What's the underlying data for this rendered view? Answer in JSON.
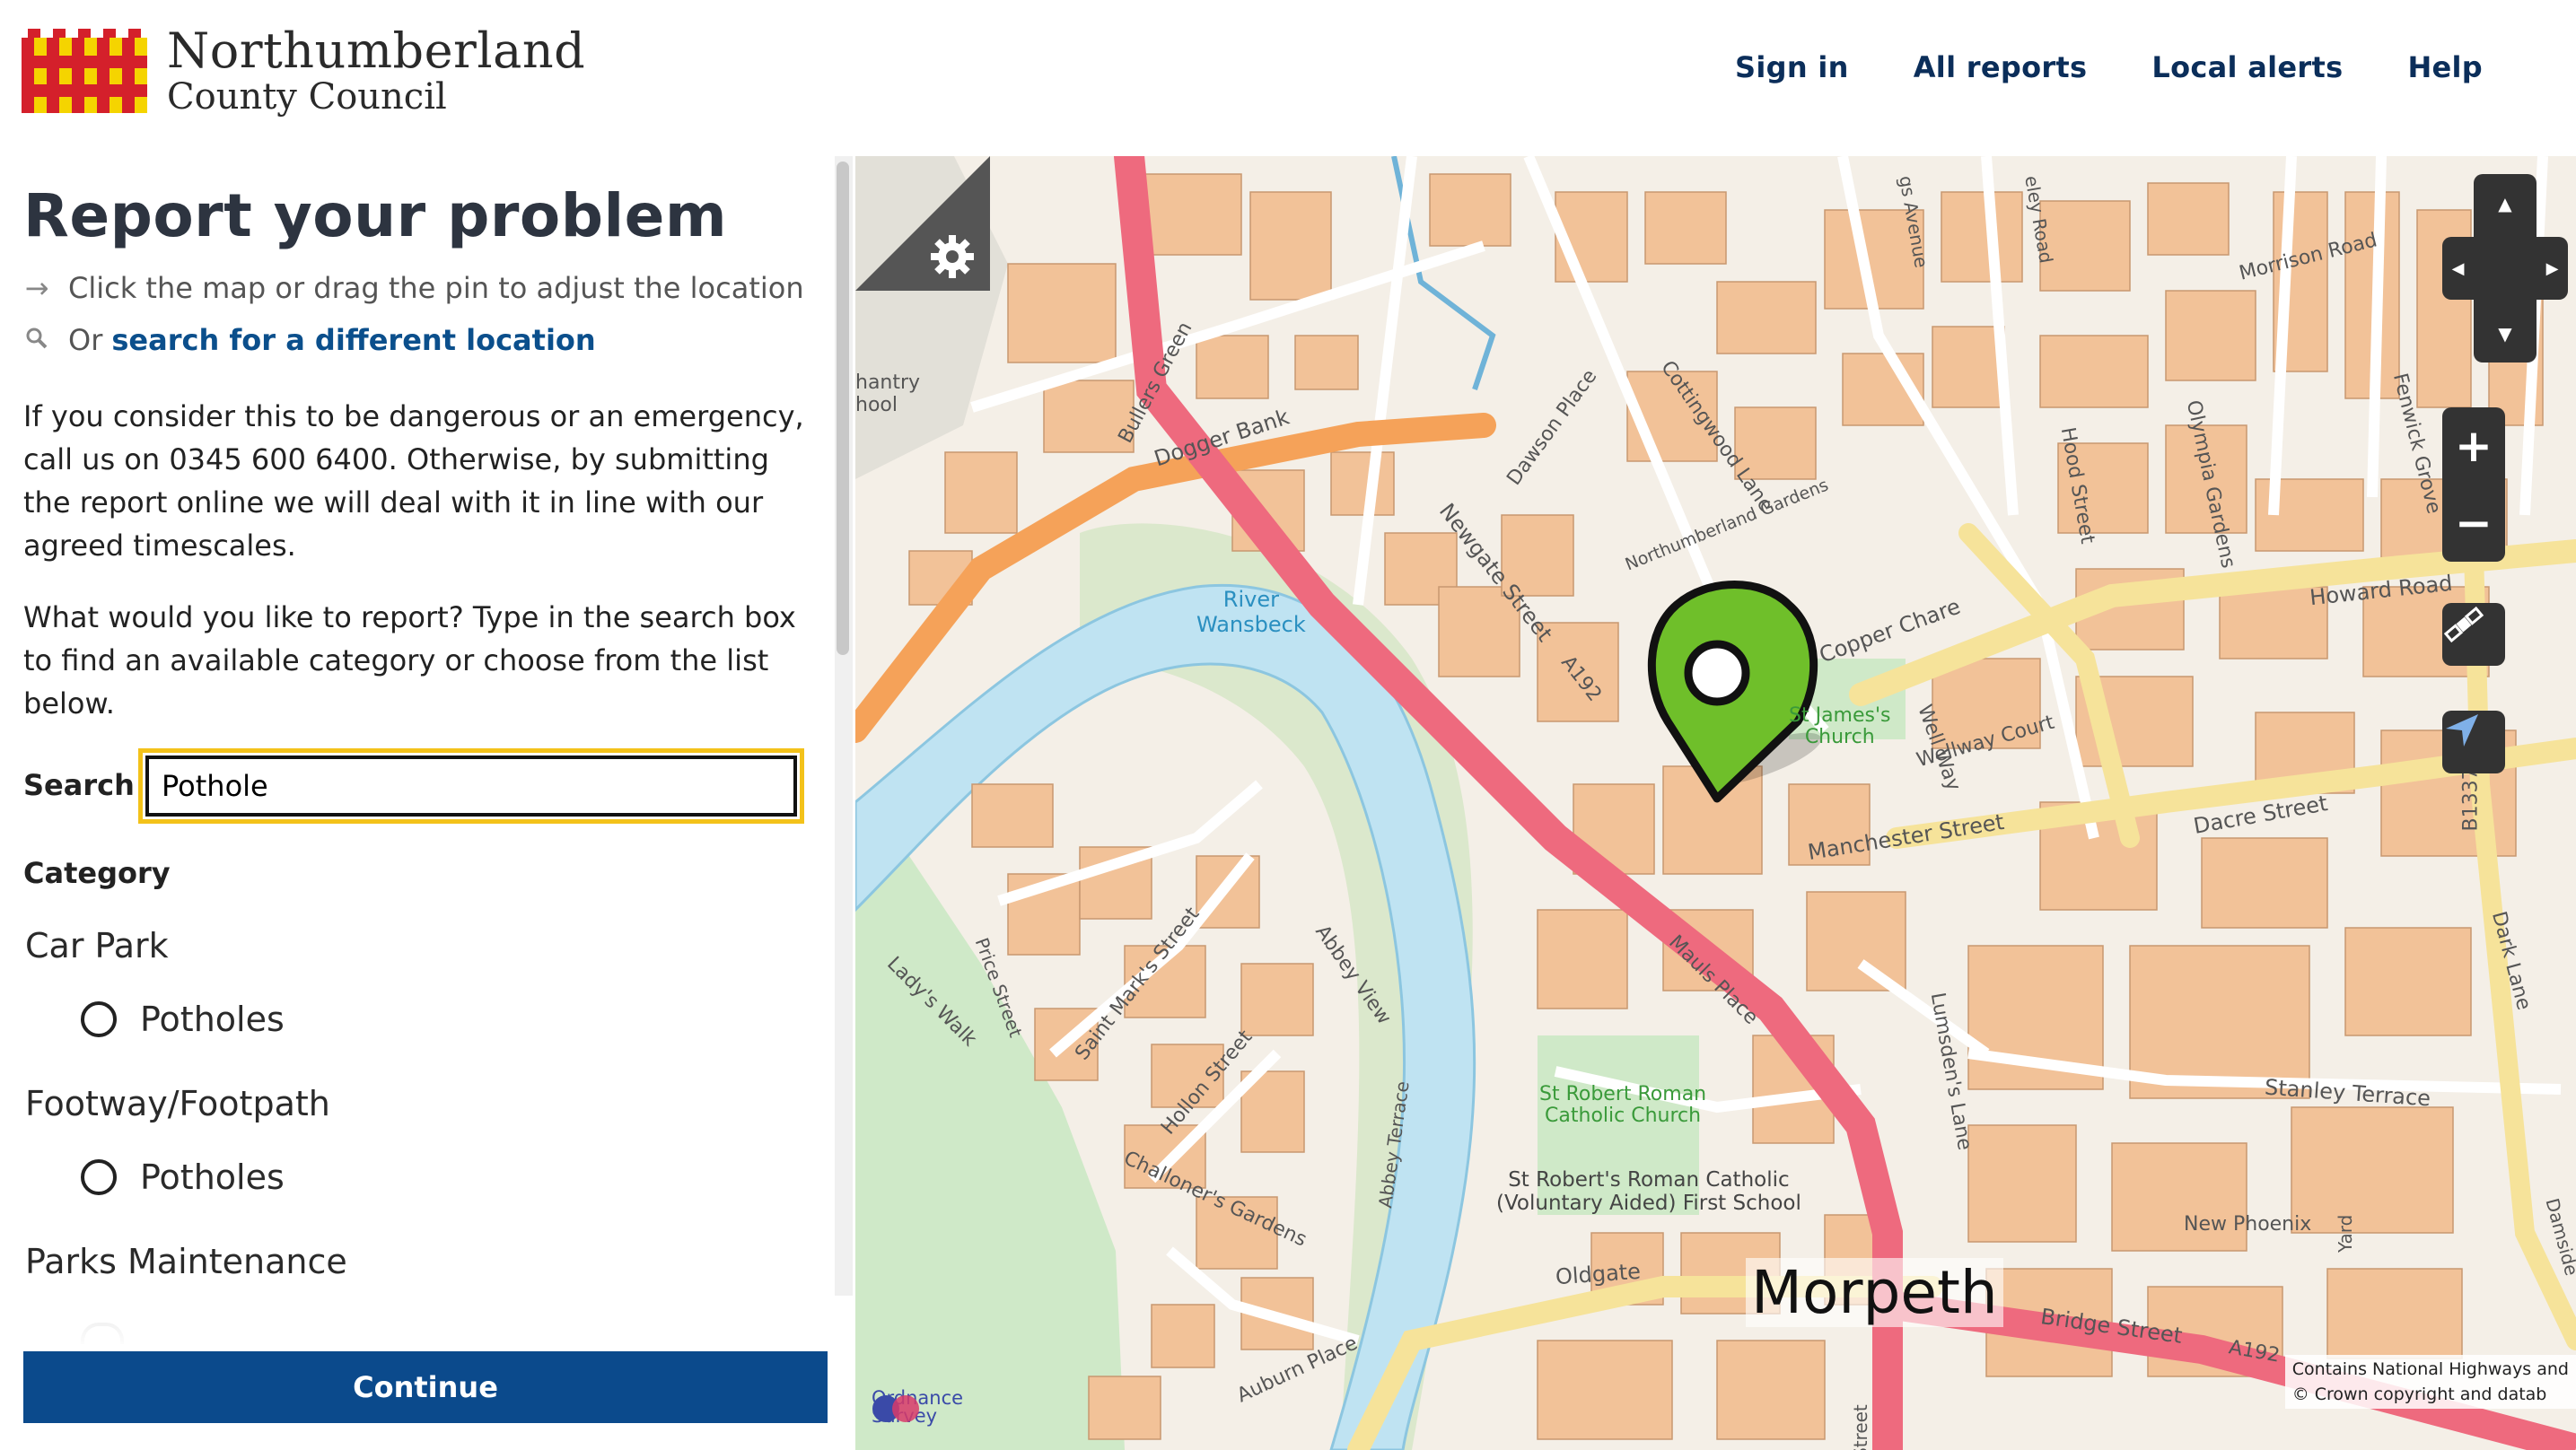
{
  "header": {
    "brand_line1": "Northumberland",
    "brand_line2": "County Council",
    "nav": [
      "Sign in",
      "All reports",
      "Local alerts",
      "Help"
    ]
  },
  "sidebar": {
    "title": "Report your problem",
    "hint_drag": "Click the map or drag the pin to adjust the location",
    "hint_or": "Or",
    "hint_search_link": "search for a different location",
    "emergency_text": "If you consider this to be dangerous or an emergency, call us on 0345 600 6400. Otherwise, by submitting the report online we will deal with it in line with our agreed timescales.",
    "instructions": "What would you like to report? Type in the search box to find an available category or choose from the list below.",
    "search_label": "Search",
    "search_value": "Pothole",
    "category_label": "Category",
    "groups": [
      {
        "name": "Car Park",
        "option": "Potholes"
      },
      {
        "name": "Footway/Footpath",
        "option": "Potholes"
      },
      {
        "name": "Parks Maintenance",
        "option": ""
      }
    ],
    "continue_label": "Continue"
  },
  "map": {
    "town_label": "Morpeth",
    "labels": {
      "river": "River",
      "river2": "Wansbeck",
      "dogger_bank": "Dogger Bank",
      "bullers_green": "Bullers Green",
      "dawson_place": "Dawson Place",
      "cottingwood_lane": "Cottingwood Lane",
      "northumberland_gardens": "Northumberland Gardens",
      "newgate_street": "Newgate Street",
      "a192": "A192",
      "copper_chare": "Copper Chare",
      "st_james": "St James's",
      "church": "Church",
      "wellway_court": "Wellway Court",
      "well_way": "Well Way",
      "manchester_street": "Manchester Street",
      "dacre_street": "Dacre Street",
      "howard_road": "Howard Road",
      "morrison_road": "Morrison Road",
      "hood_street": "Hood Street",
      "olympia_gardens": "Olympia Gardens",
      "fenwick_grove": "Fenwick Grove",
      "b1337": "B1337",
      "dark_lane": "Dark Lane",
      "stanley_terrace": "Stanley Terrace",
      "new_phoenix": "New Phoenix",
      "yard": "Yard",
      "lumsdens_lane": "Lumsden's Lane",
      "mauls_place": "Mauls Place",
      "st_robert_church_1": "St Robert Roman",
      "st_robert_church_2": "Catholic Church",
      "st_robert_school_1": "St Robert's Roman Catholic",
      "st_robert_school_2": "(Voluntary Aided) First School",
      "challoners_gardens": "Challoner's Gardens",
      "abbey_terrace": "Abbey Terrace",
      "hollon_street": "Hollon Street",
      "saint_marks_street": "Saint Mark's Street",
      "abbey_view": "Abbey View",
      "price_street": "Price Street",
      "ladys_walk": "Lady's Walk",
      "auburn_place": "Auburn Place",
      "oldgate": "Oldgate",
      "bridge_street": "Bridge Street",
      "a192b": "A192",
      "chantry_1": "hantry",
      "chantry_2": "hool",
      "bridge_st_v": "Street",
      "ss_avenue": "gs Avenue",
      "ley_road": "eley Road",
      "dark_side": "Damside"
    },
    "ordnance": "Ordnance",
    "survey": "Survey",
    "attribution_1": "Contains National Highways and",
    "attribution_2": "© Crown copyright and datab"
  },
  "colors": {
    "nav": "#0b2e5a",
    "continue_bg": "#0b4a8c",
    "search_focus": "#f3c21a",
    "pin": "#6fbf2a",
    "a_road": "#ee6a7e",
    "b_road": "#f5a259",
    "building": "#f2c298",
    "water": "#bfe3f2",
    "green": "#cfe9c8"
  }
}
